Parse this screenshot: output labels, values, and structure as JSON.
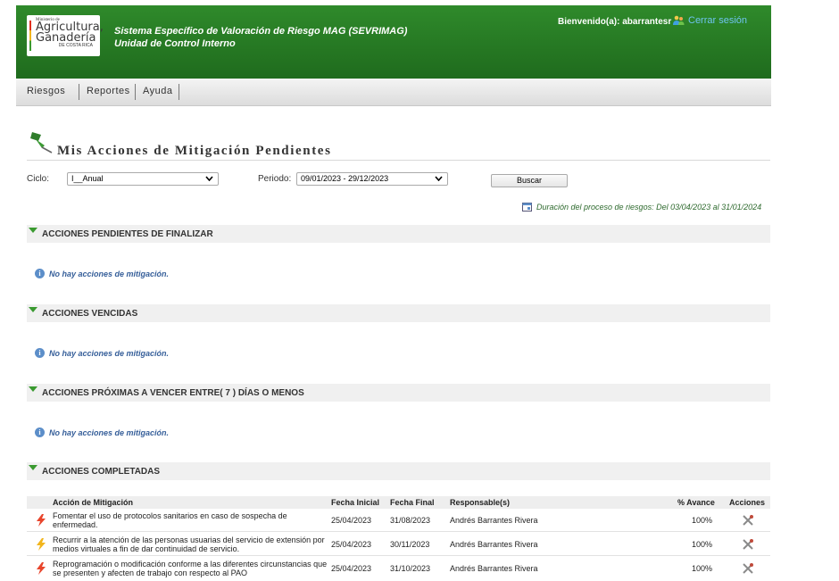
{
  "header": {
    "logo": {
      "line1": "Ministerio de",
      "line2": "Agricultura,",
      "line3": "Ganadería",
      "line4": "DE COSTA RICA"
    },
    "system_title": "Sistema Específico de Valoración de Riesgo MAG (SEVRIMAG)",
    "unit": "Unidad de Control Interno",
    "welcome": "Bienvenido(a): abarrantesr",
    "logout": "Cerrar sesión"
  },
  "nav": {
    "items": [
      "Riesgos",
      "Reportes",
      "Ayuda"
    ]
  },
  "page": {
    "title": "Mis Acciones de Mitigación Pendientes"
  },
  "filters": {
    "ciclo_label": "Ciclo:",
    "ciclo_value": "I__Anual",
    "periodo_label": "Periodo:",
    "periodo_value": "09/01/2023 - 29/12/2023",
    "search_label": "Buscar"
  },
  "duration": "Duración del proceso de riesgos: Del 03/04/2023 al 31/01/2024",
  "sections": [
    {
      "title": "ACCIONES PENDIENTES DE FINALIZAR",
      "message": "No hay acciones de mitigación."
    },
    {
      "title": "ACCIONES VENCIDAS",
      "message": "No hay acciones de mitigación."
    },
    {
      "title": "ACCIONES PRÓXIMAS A VENCER ENTRE( 7 ) DÍAS O MENOS",
      "message": "No hay acciones de mitigación."
    },
    {
      "title": "ACCIONES COMPLETADAS"
    }
  ],
  "table": {
    "headers": [
      "Acción de Mitigación",
      "Fecha Inicial",
      "Fecha Final",
      "Responsable(s)",
      "% Avance",
      "Acciones"
    ],
    "rows": [
      {
        "action": "Fomentar el uso de protocolos sanitarios en caso de sospecha de enfermedad.",
        "start": "25/04/2023",
        "end": "31/08/2023",
        "responsible": "Andrés Barrantes Rivera",
        "progress": "100%",
        "bolt_color": "#e8452c"
      },
      {
        "action": "Recurrir a la atención de las personas usuarias del servicio de extensión por medios virtuales a fin de dar continuidad de servicio.",
        "start": "25/04/2023",
        "end": "30/11/2023",
        "responsible": "Andrés Barrantes Rivera",
        "progress": "100%",
        "bolt_color": "#f2b51c"
      },
      {
        "action": "Reprogramación o modificación conforme a las diferentes circunstancias que se presenten y afecten de trabajo con respecto al PAO",
        "start": "25/04/2023",
        "end": "31/10/2023",
        "responsible": "Andrés Barrantes Rivera",
        "progress": "100%",
        "bolt_color": "#e8452c"
      }
    ]
  }
}
